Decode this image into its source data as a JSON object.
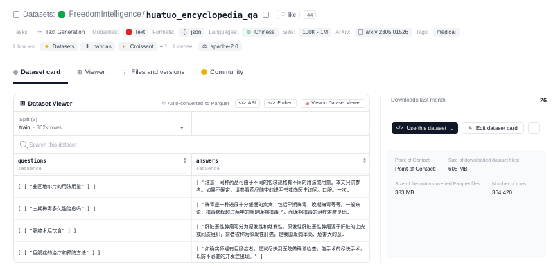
{
  "header": {
    "prefix": "Datasets:",
    "org": "FreedomIntelligence",
    "separator": "/",
    "repo": "huatuo_encyclopedia_qa",
    "like_label": "like",
    "like_count": "44"
  },
  "tags_row1": {
    "tasks_label": "Tasks:",
    "task": "Text Generation",
    "modalities_label": "Modalities:",
    "modality": "Text",
    "formats_label": "Formats:",
    "format": "json",
    "languages_label": "Languages:",
    "language": "Chinese",
    "size_label": "Size:",
    "size": "100K - 1M",
    "arxiv_label": "ArXiv:",
    "arxiv": "arxiv:2305.01526",
    "tags_label": "Tags:",
    "tag": "medical"
  },
  "tags_row2": {
    "libraries_label": "Libraries:",
    "lib1": "Datasets",
    "lib2": "pandas",
    "lib3": "Croissant",
    "more": "+ 1",
    "license_label": "License:",
    "license": "apache-2.0"
  },
  "tabs": [
    {
      "label": "Dataset card"
    },
    {
      "label": "Viewer"
    },
    {
      "label": "Files and versions"
    },
    {
      "label": "Community"
    }
  ],
  "viewer": {
    "title": "Dataset Viewer",
    "auto_converted": "Auto-converted",
    "to_parquet": "to Parquet",
    "api_label": "API",
    "embed_label": "Embed",
    "view_label": "View in Dataset Viewer",
    "split_label": "Split (3)",
    "split_name": "train",
    "split_rows": "· 362k rows",
    "search_placeholder": "Search this dataset",
    "columns": [
      {
        "name": "questions",
        "type": "sequence"
      },
      {
        "name": "answers",
        "type": "sequence"
      }
    ],
    "rows": [
      {
        "q": "[ [ \"曲匹地尔片的用法用量\" ] ]",
        "a": "[ \"注意：同种药品可由于不同的包装规格有不同的用法或用量。本文只供参考。如果不确定，请参看药品随带的说明书或向医生询问。口服。一次…"
      },
      {
        "q": "[ [ \"三期梅毒多久能治愈吗\" ] ]",
        "a": "[ \"梅毒是一种进展十分缓慢的疾病，包括早期梅毒，晚期梅毒等等。一般来说，梅毒病程超过两年的就是晚期梅毒了，而晚期梅毒的治疗难度是比…"
      },
      {
        "q": "[ [ \"肝癌术后饮食\" ] ]",
        "a": "[ \"肝脏恶性肿瘤可分为原发性和继发性。原发性肝脏恶性肿瘤源于肝脏的上皮或间质组织，前者被称为原发性肝癌，是我国发病率高、危害大的恶…"
      },
      {
        "q": "[ [ \"巨肠症的治疗和预防方法\" ] ]",
        "a": "[ \"如确实怀疑有巨肠症者，建议尽快到医院做确诊检查，能手术的尽快手术，以防不必要的并发症出现。\" ]"
      }
    ]
  },
  "side": {
    "downloads_label": "Downloads last month",
    "downloads": "26",
    "use_label": "Use this dataset",
    "edit_label": "Edit dataset card",
    "more_label": "⋮",
    "contact_label": "Point of Contact:",
    "contact_value": "Point of Contact:",
    "size_dl_label": "Size of downloaded dataset files:",
    "size_dl": "608 MB",
    "size_pq_label": "Size of the auto-converted Parquet files:",
    "size_pq": "383 MB",
    "rows_label": "Number of rows:",
    "rows": "364,420"
  },
  "colors": {
    "accent_dark": "#111827",
    "emoji_org": "#16a34a",
    "modality_red": "#dc2626",
    "community_yellow": "#eab308"
  }
}
